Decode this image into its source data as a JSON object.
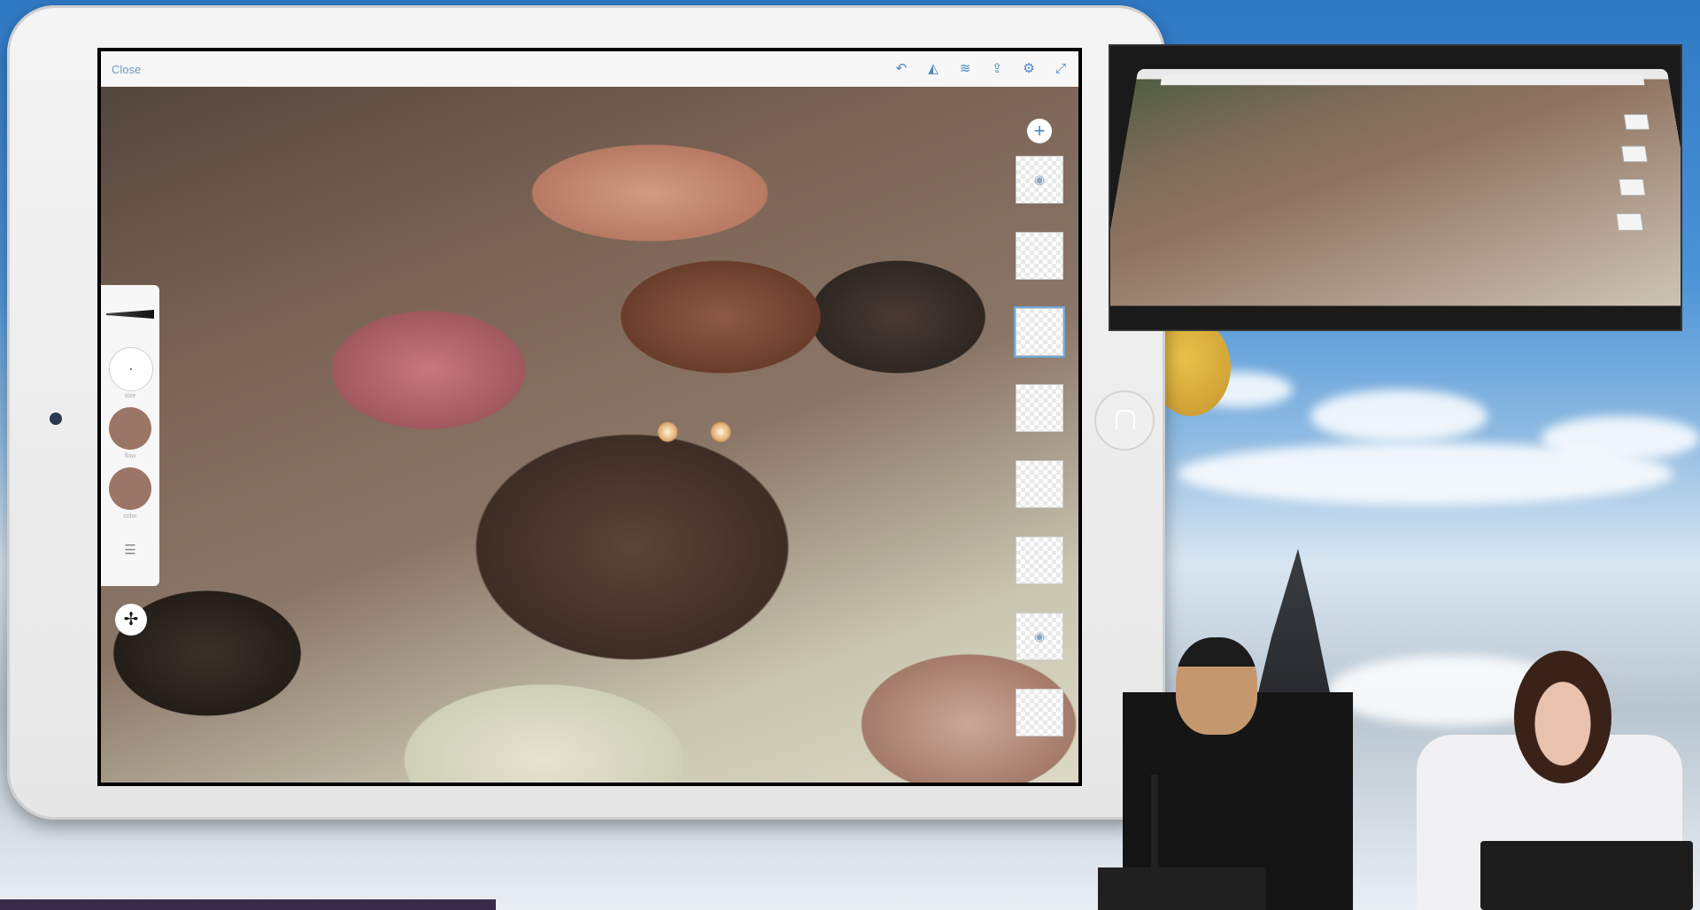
{
  "app": {
    "close_label": "Close",
    "toolbar_icons": [
      "undo-icon",
      "color-picker-icon",
      "layers-icon",
      "share-icon",
      "settings-icon",
      "fullscreen-icon"
    ]
  },
  "brush_panel": {
    "size_label": "size",
    "flow_label": "flow",
    "color_label": "color",
    "swatch_color": "#9b7565",
    "settings_icon": "sliders-icon"
  },
  "layers_panel": {
    "add_label": "+",
    "layers": [
      {
        "name": "layer-1",
        "selected": false,
        "label": ""
      },
      {
        "name": "layer-2",
        "selected": false,
        "label": ""
      },
      {
        "name": "layer-3",
        "selected": true,
        "label": ""
      },
      {
        "name": "layer-4",
        "selected": false,
        "label": ""
      },
      {
        "name": "layer-5",
        "selected": false,
        "label": ""
      },
      {
        "name": "layer-6",
        "selected": false,
        "label": ""
      },
      {
        "name": "layer-7",
        "selected": false,
        "label": ""
      },
      {
        "name": "layer-8",
        "selected": false,
        "label": ""
      }
    ]
  },
  "colors": {
    "accent": "#4d86c0",
    "tablet_frame": "#f0f0f0"
  }
}
